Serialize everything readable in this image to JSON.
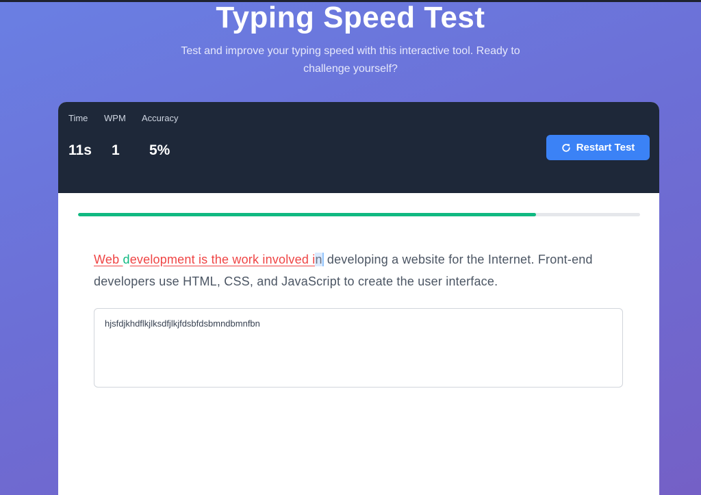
{
  "header": {
    "title": "Typing Speed Test",
    "subtitle": "Test and improve your typing speed with this interactive tool. Ready to challenge yourself?"
  },
  "stats": {
    "time_label": "Time",
    "time_value": "11s",
    "wpm_label": "WPM",
    "wpm_value": "1",
    "accuracy_label": "Accuracy",
    "accuracy_value": "5%"
  },
  "restart_button": {
    "label": "Restart Test",
    "icon": "rotate-icon"
  },
  "progress": {
    "fraction": 0.815
  },
  "passage": {
    "segments": [
      {
        "text": "Web ",
        "state": "incorrect"
      },
      {
        "text": "d",
        "state": "correct"
      },
      {
        "text": "evelopment is the work involved i",
        "state": "incorrect"
      },
      {
        "text": "n",
        "state": "current"
      },
      {
        "text": " developing a website for the Internet. Front-end developers use HTML, CSS, and JavaScript to create the user interface.",
        "state": "pending"
      }
    ]
  },
  "input": {
    "value": "hjsfdjkhdflkjlksdfjlkjfdsbfdsbmndbmnfbn"
  },
  "colors": {
    "correct": "#10b981",
    "incorrect": "#ef4444",
    "accent": "#3b82f6",
    "stats_bg": "#1e2839"
  }
}
